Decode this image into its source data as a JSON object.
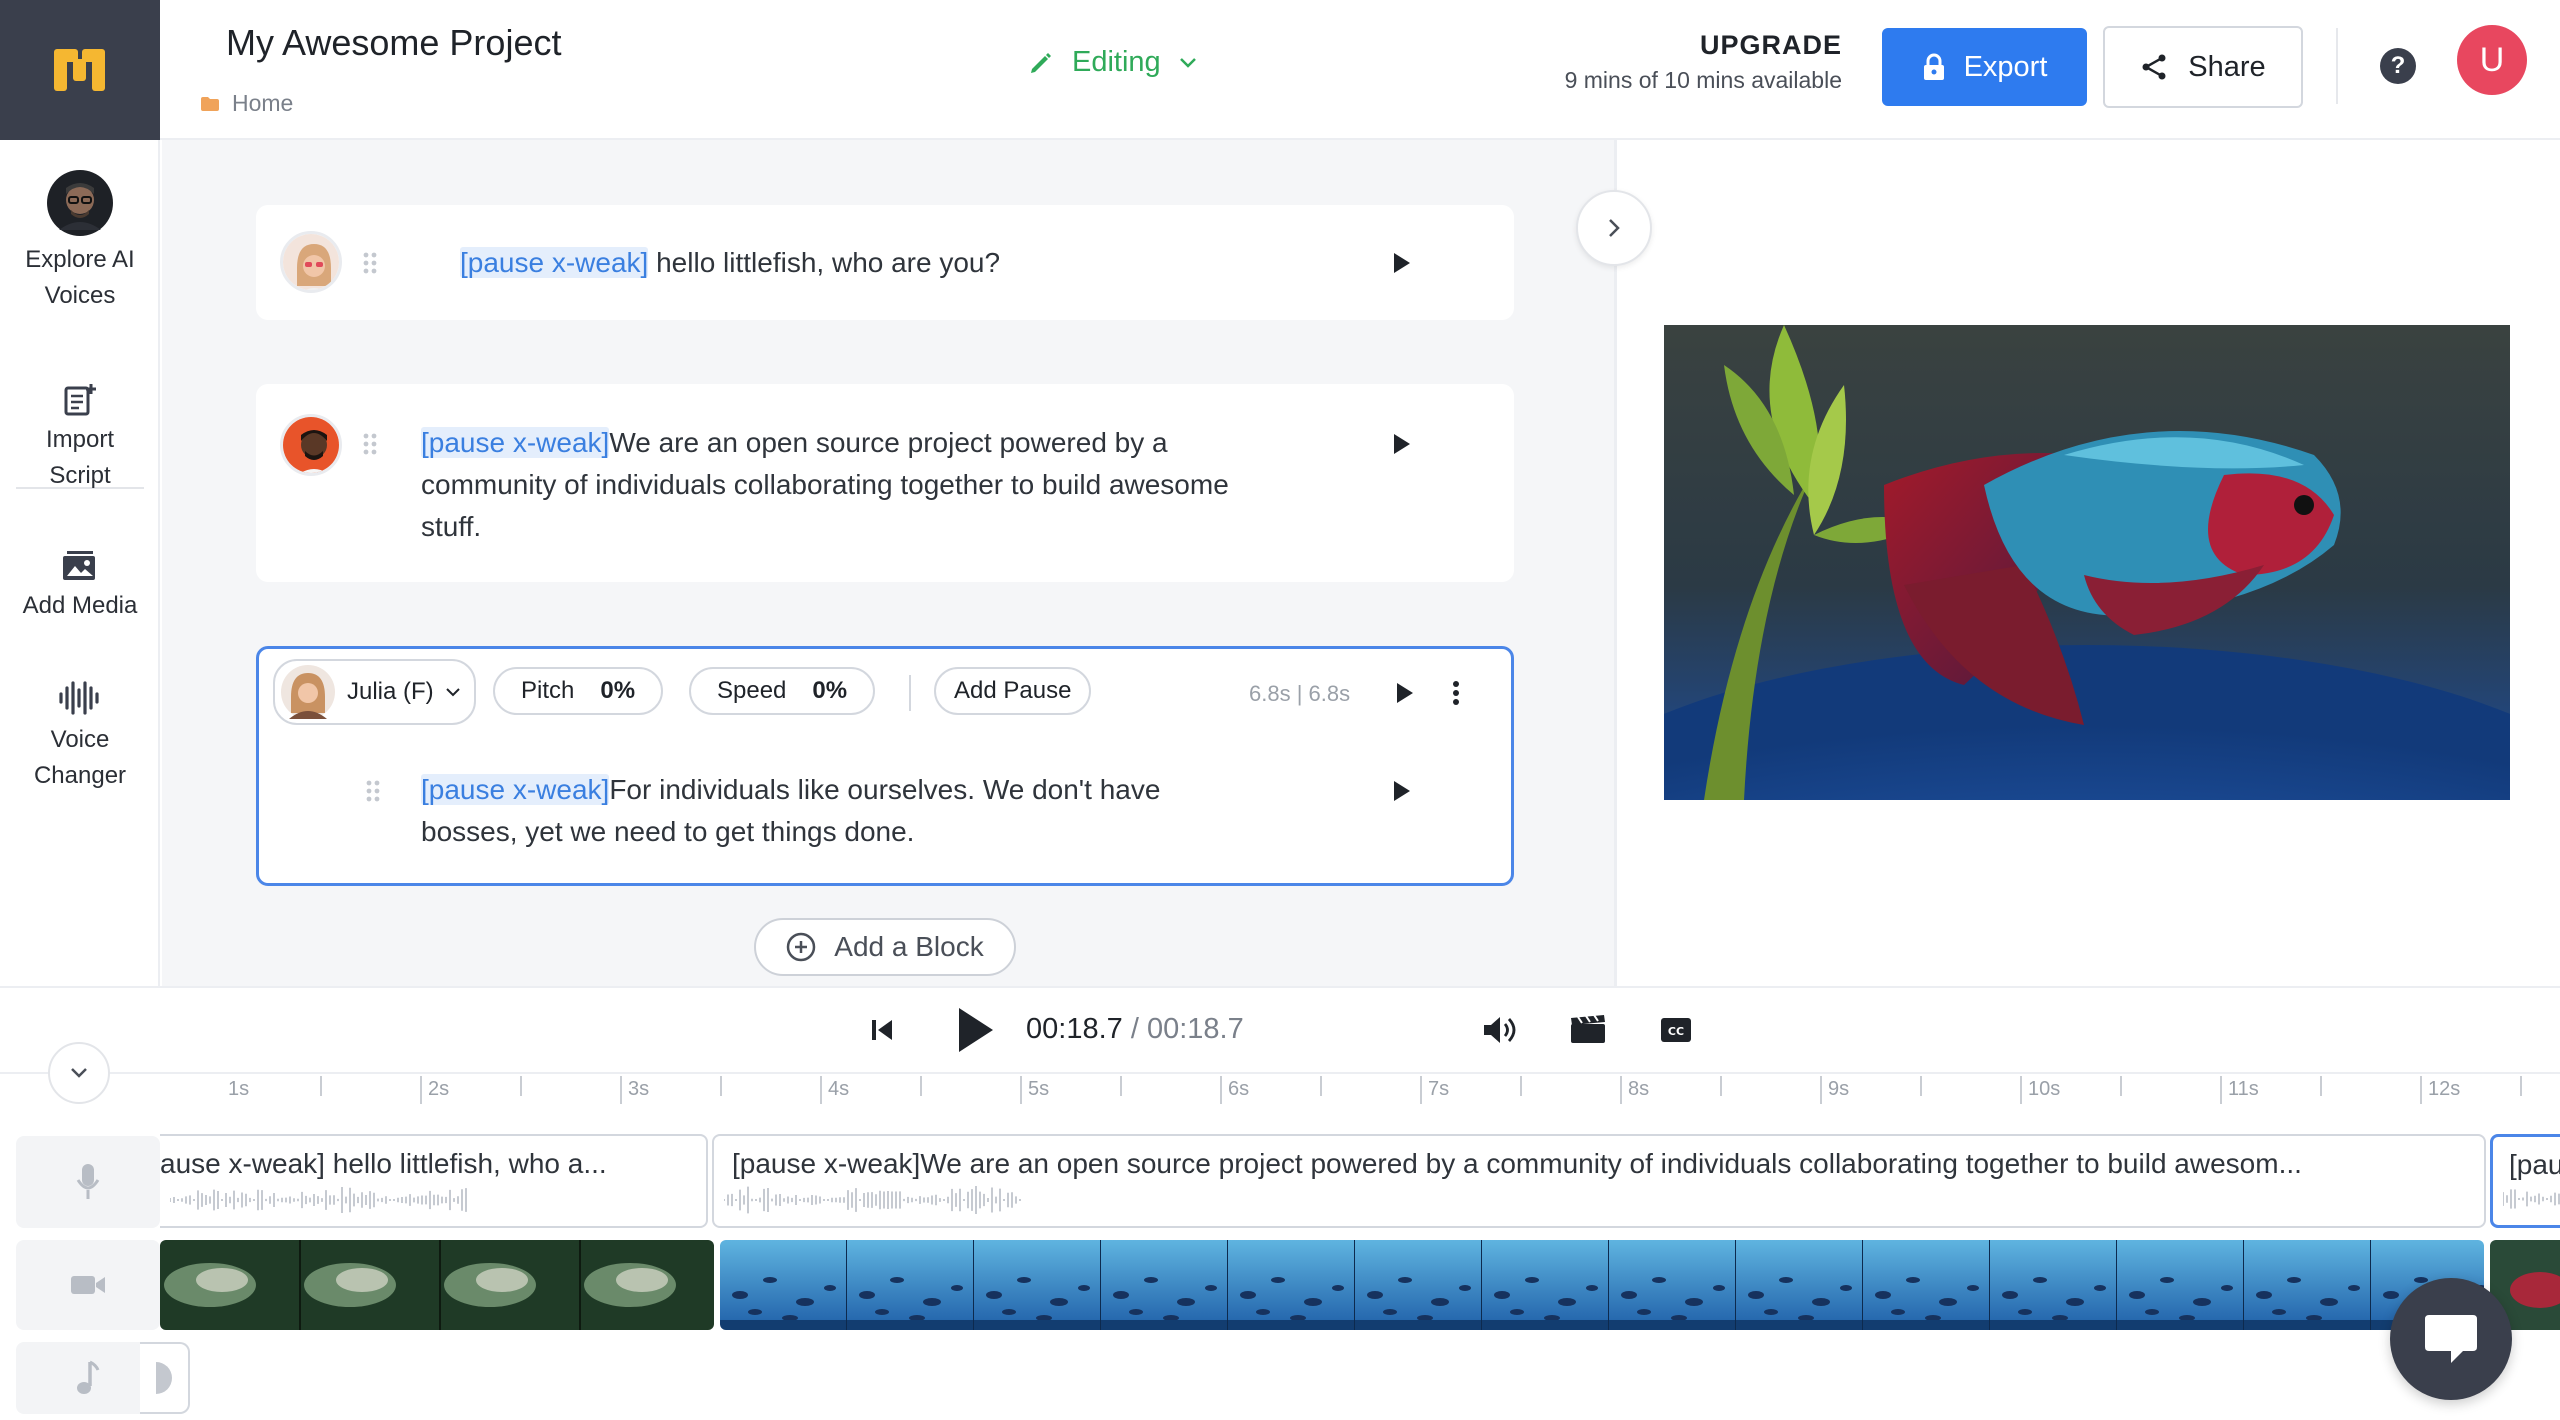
{
  "header": {
    "project_title": "My Awesome Project",
    "breadcrumb": "Home",
    "mode": "Editing",
    "upgrade_label": "UPGRADE",
    "minutes_available": "9 mins of 10 mins available",
    "export_label": "Export",
    "share_label": "Share",
    "help_label": "?",
    "avatar_letter": "U"
  },
  "sidebar": {
    "items": [
      {
        "label_line1": "Explore AI",
        "label_line2": "Voices",
        "icon": "ai-voice-avatar-icon"
      },
      {
        "label_line1": "Import",
        "label_line2": "Script",
        "icon": "import-script-icon"
      },
      {
        "label_line1": "Add Media",
        "label_line2": "",
        "icon": "add-media-icon"
      },
      {
        "label_line1": "Voice",
        "label_line2": "Changer",
        "icon": "voice-changer-icon"
      }
    ]
  },
  "editor": {
    "blocks": [
      {
        "pause_tag": "[pause x-weak]",
        "text": " hello littlefish, who are you?"
      },
      {
        "pause_tag": "[pause x-weak]",
        "text": "We are an open source project powered by a community of individuals collaborating together to build awesome stuff."
      },
      {
        "voice": "Julia (F)",
        "pitch_label": "Pitch",
        "pitch_value": "0%",
        "speed_label": "Speed",
        "speed_value": "0%",
        "add_pause_label": "Add Pause",
        "duration": "6.8s | 6.8s",
        "pause_tag": "[pause x-weak]",
        "text": "For individuals like ourselves. We don't have bosses, yet we need to get things done."
      }
    ],
    "add_block_label": "Add a Block"
  },
  "player": {
    "current_time": "00:18.7",
    "separator": "/",
    "total_time": "00:18.7"
  },
  "timeline": {
    "tick_labels": [
      "1s",
      "2s",
      "3s",
      "4s",
      "5s",
      "6s",
      "7s",
      "8s",
      "9s",
      "10s",
      "11s",
      "12s"
    ],
    "voice_clips": [
      "ause x-weak] hello littlefish, who a...",
      "[pause x-weak]We are an open source project powered by a community of individuals collaborating together to build awesom...",
      "[pau"
    ]
  },
  "colors": {
    "accent_blue": "#2e7bef",
    "editing_green": "#2faa59",
    "avatar_red": "#e8475f",
    "pause_tag_blue": "#3a7fe0",
    "dark_chrome": "#3a3f4c"
  }
}
